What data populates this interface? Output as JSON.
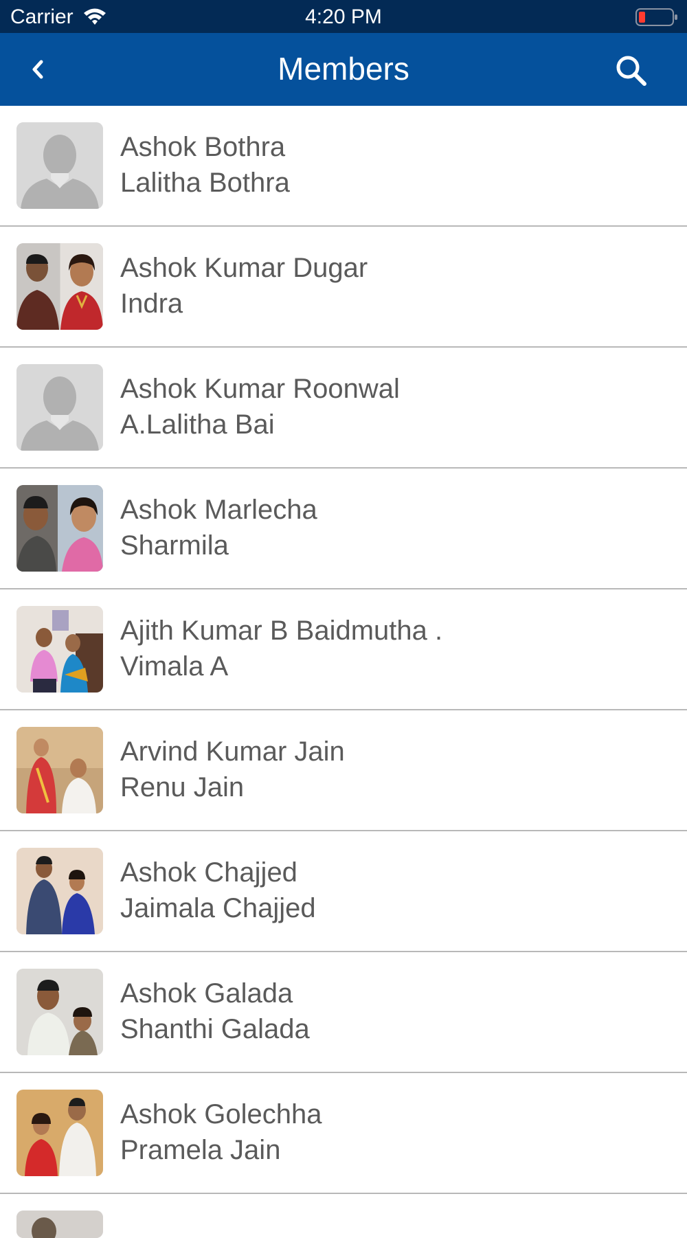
{
  "status_bar": {
    "carrier": "Carrier",
    "time": "4:20 PM",
    "battery_color": "#ff3b30"
  },
  "nav": {
    "title": "Members",
    "back_icon": "chevron-left-icon",
    "search_icon": "search-icon",
    "bar_color": "#05519c",
    "status_color": "#032a55"
  },
  "members": [
    {
      "name": "Ashok Bothra",
      "spouse": "Lalitha Bothra",
      "avatar": "placeholder"
    },
    {
      "name": "Ashok Kumar Dugar",
      "spouse": "Indra",
      "avatar": "photo"
    },
    {
      "name": "Ashok Kumar Roonwal",
      "spouse": "A.Lalitha Bai",
      "avatar": "placeholder"
    },
    {
      "name": "Ashok Marlecha",
      "spouse": "Sharmila",
      "avatar": "photo"
    },
    {
      "name": "Ajith Kumar B Baidmutha .",
      "spouse": "Vimala A",
      "avatar": "photo"
    },
    {
      "name": "Arvind Kumar Jain",
      "spouse": "Renu Jain",
      "avatar": "photo"
    },
    {
      "name": "Ashok Chajjed",
      "spouse": "Jaimala Chajjed",
      "avatar": "photo"
    },
    {
      "name": "Ashok Galada",
      "spouse": "Shanthi Galada",
      "avatar": "photo"
    },
    {
      "name": "Ashok Golechha",
      "spouse": "Pramela Jain",
      "avatar": "photo"
    }
  ]
}
